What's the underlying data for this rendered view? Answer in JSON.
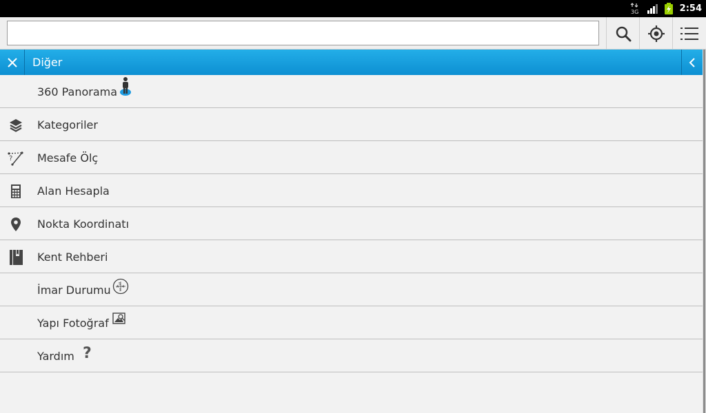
{
  "status_bar": {
    "network_label": "3G",
    "time": "2:54"
  },
  "search": {
    "value": "",
    "placeholder": ""
  },
  "header": {
    "title": "Diğer"
  },
  "menu": {
    "items": [
      {
        "label": "360 Panorama",
        "icon": "street-view-person-icon"
      },
      {
        "label": "Kategoriler",
        "icon": "layers-icon"
      },
      {
        "label": "Mesafe Ölç",
        "icon": "measure-distance-icon"
      },
      {
        "label": "Alan Hesapla",
        "icon": "calculator-icon"
      },
      {
        "label": "Nokta Koordinatı",
        "icon": "location-pin-icon"
      },
      {
        "label": "Kent Rehberi",
        "icon": "city-guide-book-icon"
      },
      {
        "label": "İmar Durumu",
        "icon": "zoning-status-icon"
      },
      {
        "label": "Yapı Fotoğraf",
        "icon": "photo-icon"
      },
      {
        "label": "Yardım",
        "icon": "help-question-icon"
      }
    ]
  },
  "colors": {
    "header_blue": "#1a9fe0",
    "background": "#f2f2f2",
    "icon_gray": "#444444"
  }
}
